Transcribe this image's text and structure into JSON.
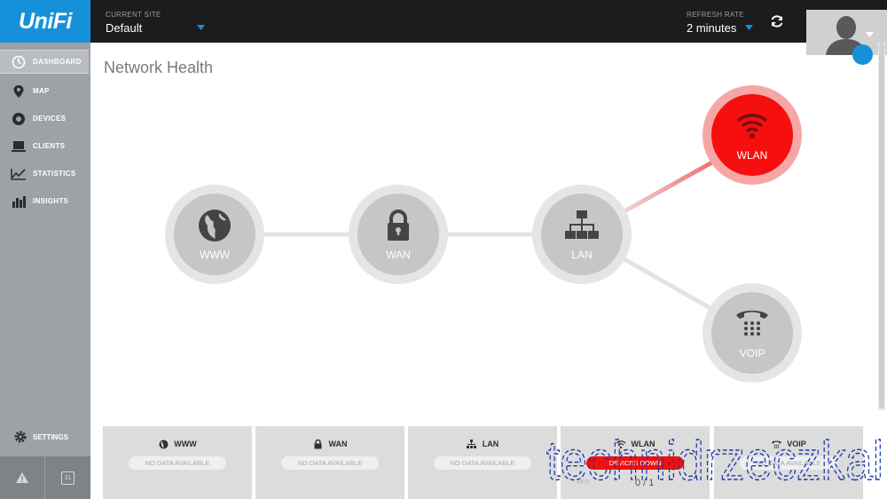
{
  "app": {
    "brand": "UniFi"
  },
  "header": {
    "site_label": "CURRENT SITE",
    "site_value": "Default",
    "refresh_label": "REFRESH RATE",
    "refresh_value": "2 minutes"
  },
  "sidebar": {
    "items": [
      {
        "label": "DASHBOARD",
        "icon": "dashboard-icon",
        "active": true
      },
      {
        "label": "MAP",
        "icon": "map-pin-icon"
      },
      {
        "label": "DEVICES",
        "icon": "devices-icon"
      },
      {
        "label": "CLIENTS",
        "icon": "laptop-icon"
      },
      {
        "label": "STATISTICS",
        "icon": "chart-line-icon"
      },
      {
        "label": "INSIGHTS",
        "icon": "bar-chart-icon"
      }
    ],
    "settings_label": "SETTINGS",
    "calendar_day": "31"
  },
  "main": {
    "title": "Network Health",
    "nodes": [
      {
        "label": "WWW",
        "status": "ok"
      },
      {
        "label": "WAN",
        "status": "ok"
      },
      {
        "label": "LAN",
        "status": "ok"
      },
      {
        "label": "WLAN",
        "status": "error"
      },
      {
        "label": "VOIP",
        "status": "ok"
      }
    ]
  },
  "cards": [
    {
      "title": "WWW",
      "status": "NO DATA AVAILABLE"
    },
    {
      "title": "WAN",
      "status": "NO DATA AVAILABLE"
    },
    {
      "title": "LAN",
      "status": "NO DATA AVAILABLE"
    },
    {
      "title": "WLAN",
      "status": "DEVICES DOWN",
      "metric_label": "APS",
      "metric_value": "0 / 1"
    },
    {
      "title": "VOIP",
      "status": "NO DATA AVAILABLE"
    }
  ],
  "colors": {
    "accent": "#1691d9",
    "error": "#f50f0f",
    "sidebar": "#9ea2a6",
    "topbar": "#1b1c1e"
  },
  "watermark": "technidrzeczkal"
}
